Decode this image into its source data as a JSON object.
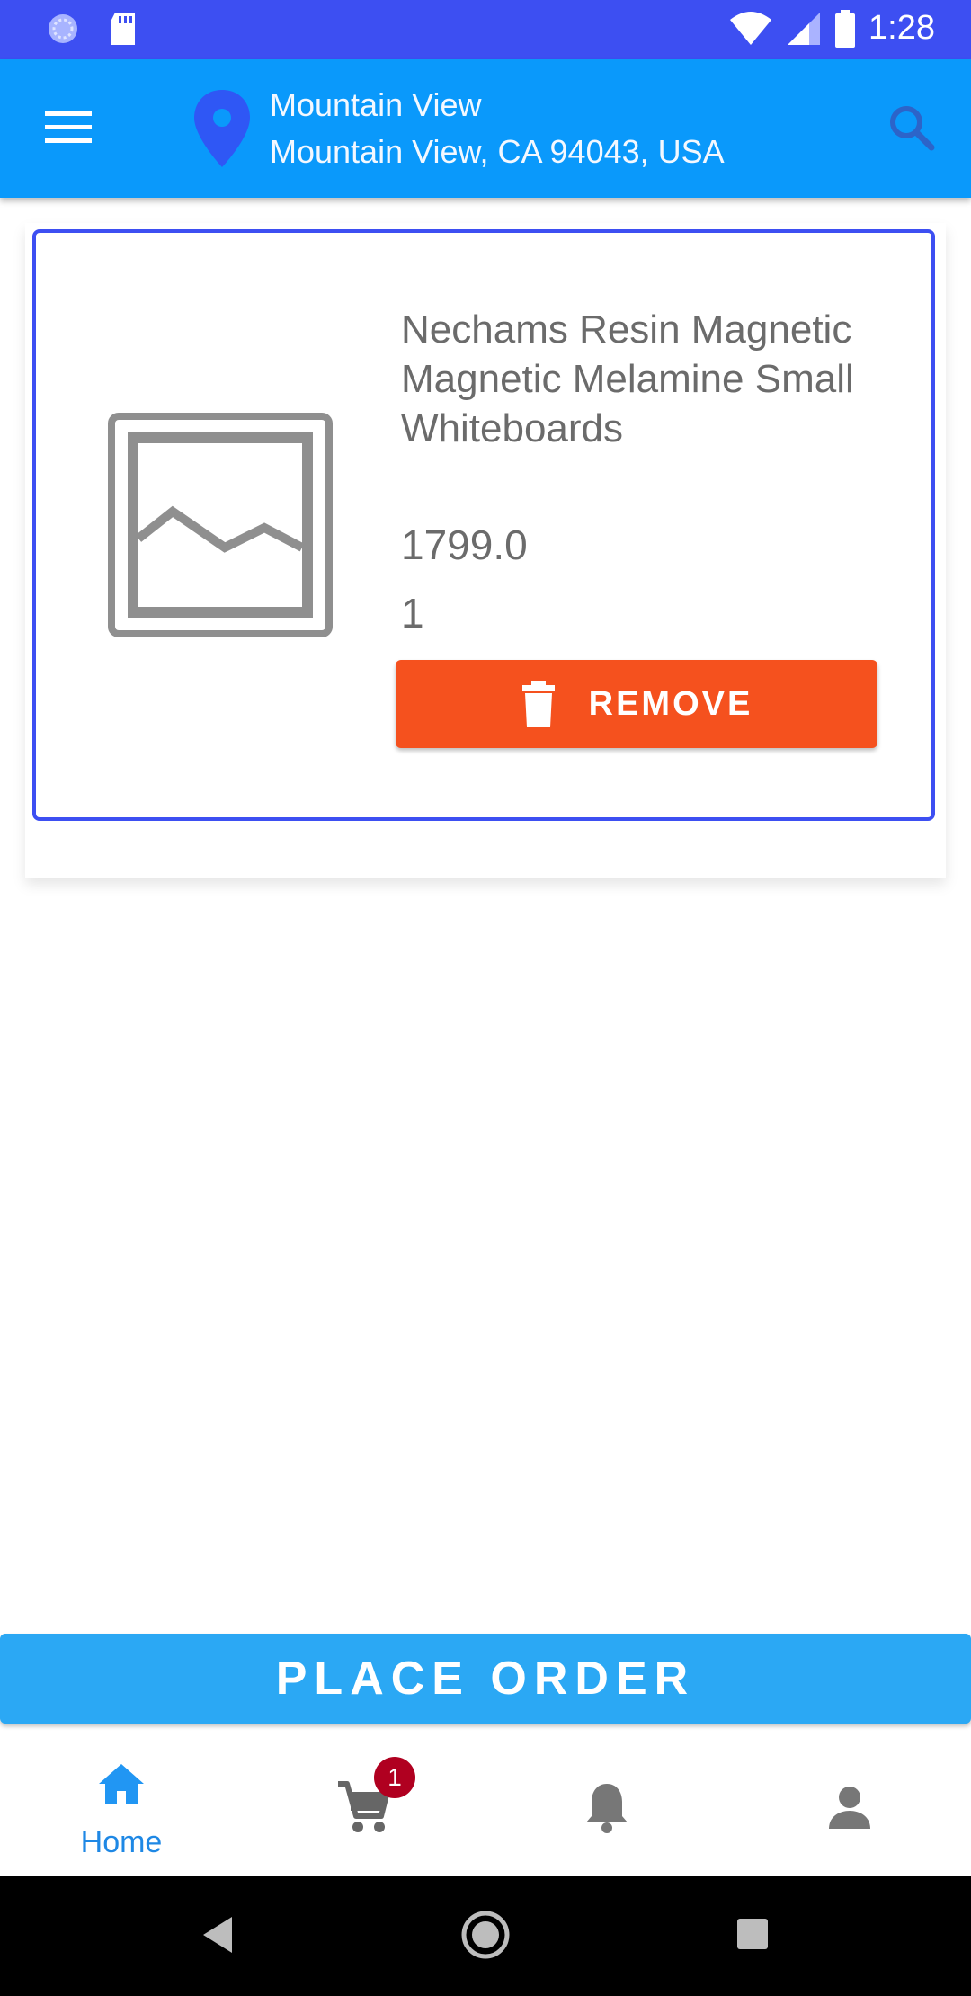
{
  "status_bar": {
    "time": "1:28"
  },
  "header": {
    "location_title": "Mountain View",
    "location_address": "Mountain View, CA 94043, USA"
  },
  "cart": {
    "items": [
      {
        "name": "Nechams Resin Magnetic Magnetic Melamine Small Whiteboards",
        "price": "1799.0",
        "quantity": "1",
        "remove_label": "REMOVE"
      }
    ]
  },
  "place_order_label": "PLACE ORDER",
  "bottom_nav": {
    "home_label": "Home",
    "cart_badge": "1"
  },
  "colors": {
    "status_bar": "#3d4ff2",
    "app_bar": "#0a99fb",
    "remove_button": "#f5511e",
    "place_order": "#2ba8f4",
    "active_nav": "#1e88e5",
    "badge": "#b00020"
  },
  "icons": [
    "menu-icon",
    "location-pin-icon",
    "search-icon",
    "image-placeholder-icon",
    "trash-icon",
    "home-icon",
    "cart-icon",
    "bell-icon",
    "person-icon",
    "back-icon",
    "home-circle-icon",
    "recents-icon"
  ]
}
